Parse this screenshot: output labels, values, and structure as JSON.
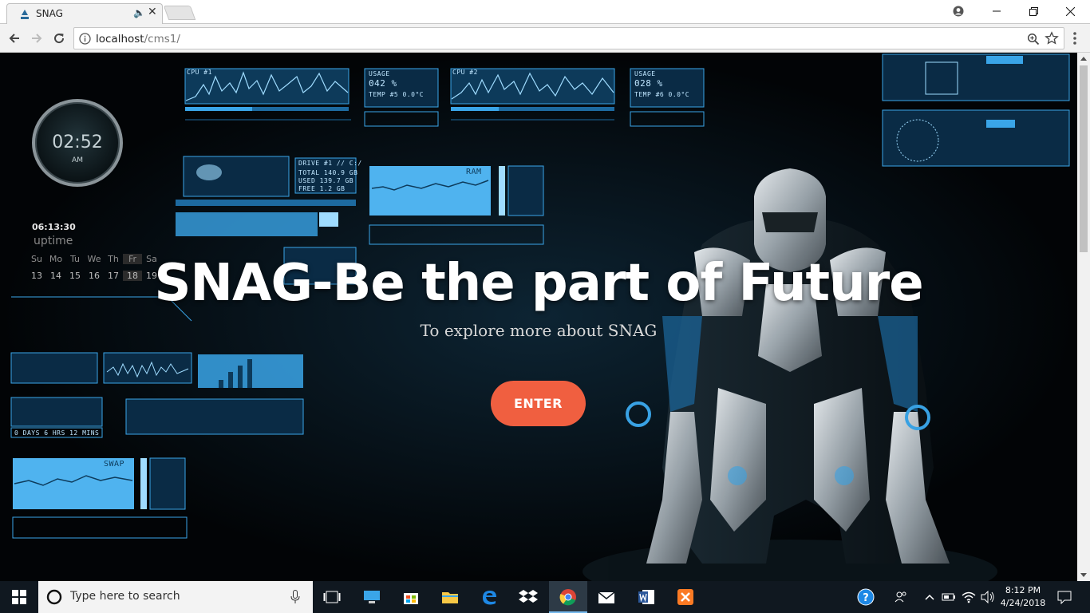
{
  "browser": {
    "tab_title": "SNAG",
    "url_host": "localhost",
    "url_path": "/cms1/"
  },
  "hud": {
    "clock_time": "02:52",
    "clock_ampm": "AM",
    "uptime_value": "06:13:30",
    "uptime_label": "uptime",
    "days": [
      "Su",
      "Mo",
      "Tu",
      "We",
      "Th",
      "Fr",
      "Sa"
    ],
    "dates": [
      "13",
      "14",
      "15",
      "16",
      "17",
      "18",
      "19"
    ],
    "cpu1_label": "CPU #1",
    "cpu2_label": "CPU #2",
    "usage1": "042 %",
    "usage2": "028 %",
    "usage_label": "USAGE",
    "temp1": "TEMP #5   0.0°C",
    "temp2": "TEMP #6   0.0°C",
    "ram_label": "RAM",
    "swap_label": "SWAP",
    "drive_label": "DRIVE #1 // C:/",
    "drive_total": "TOTAL  140.9 GB",
    "drive_used": "USED   139.7 GB",
    "drive_free": "FREE     1.2 GB",
    "days_uptime": "0 DAYS  6 HRS 12 MINS"
  },
  "hero": {
    "title": "SNAG-Be the part of Future",
    "subtitle": "To explore more about SNAG",
    "button": "ENTER"
  },
  "taskbar": {
    "search_placeholder": "Type here to search",
    "time": "8:12 PM",
    "date": "4/24/2018"
  },
  "colors": {
    "accent": "#f05f40",
    "hud_blue": "#3aa5e8"
  }
}
